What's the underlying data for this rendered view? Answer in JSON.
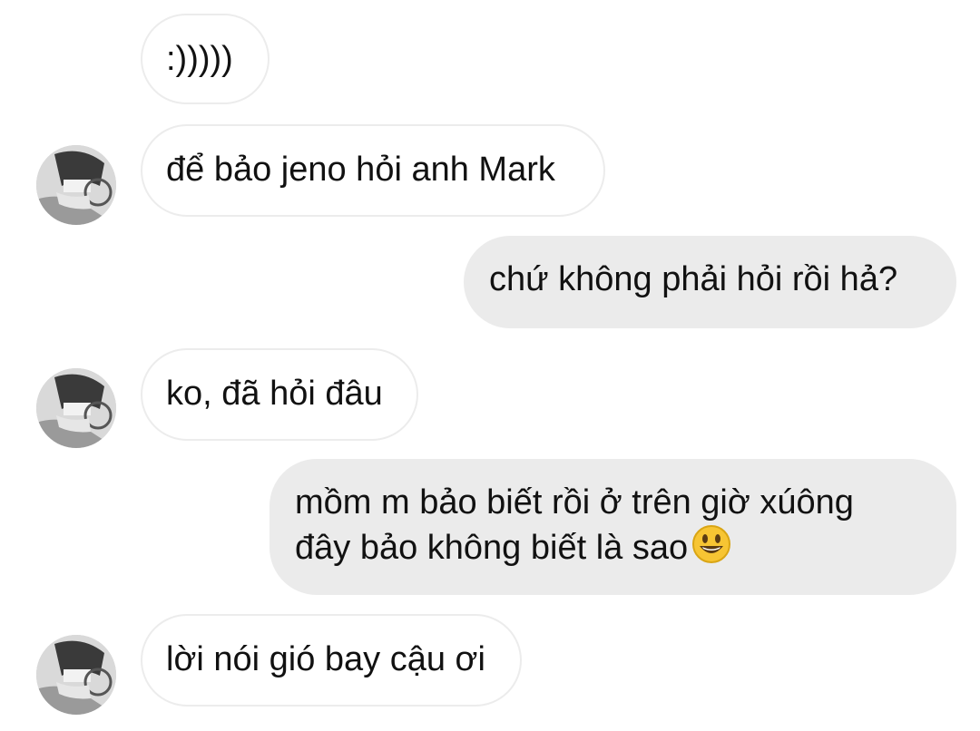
{
  "messages": [
    {
      "sender": "them",
      "text": ":)))))"
    },
    {
      "sender": "them",
      "text": "để bảo jeno hỏi anh Mark"
    },
    {
      "sender": "me",
      "text": "chứ không phải hỏi rồi hả?"
    },
    {
      "sender": "them",
      "text": "ko, đã hỏi đâu"
    },
    {
      "sender": "me",
      "line1": "mồm m bảo biết rồi ở trên giờ xúông",
      "line2": "đây bảo không biết là sao",
      "emoji": "smiling-face-emoji"
    },
    {
      "sender": "them",
      "text": "lời nói gió bay cậu ơi"
    }
  ],
  "colors": {
    "incoming_bubble": "#ffffff",
    "incoming_border": "#ececec",
    "outgoing_bubble": "#ebebeb",
    "text": "#111111"
  }
}
